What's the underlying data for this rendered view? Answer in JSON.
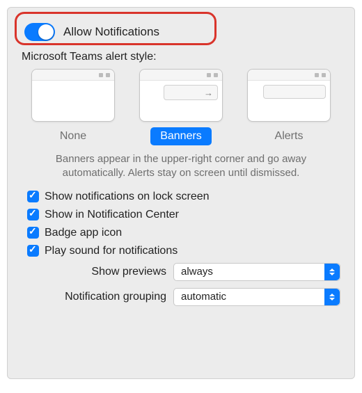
{
  "toggle": {
    "label": "Allow Notifications",
    "on": true
  },
  "subheading": "Microsoft Teams alert style:",
  "styles": {
    "none": {
      "label": "None",
      "selected": false
    },
    "banners": {
      "label": "Banners",
      "selected": true
    },
    "alerts": {
      "label": "Alerts",
      "selected": false
    }
  },
  "description": "Banners appear in the upper-right corner and go away automatically. Alerts stay on screen until dismissed.",
  "checks": {
    "lock_screen": "Show notifications on lock screen",
    "notif_center": "Show in Notification Center",
    "badge": "Badge app icon",
    "sound": "Play sound for notifications"
  },
  "selects": {
    "previews": {
      "label": "Show previews",
      "value": "always"
    },
    "grouping": {
      "label": "Notification grouping",
      "value": "automatic"
    }
  }
}
